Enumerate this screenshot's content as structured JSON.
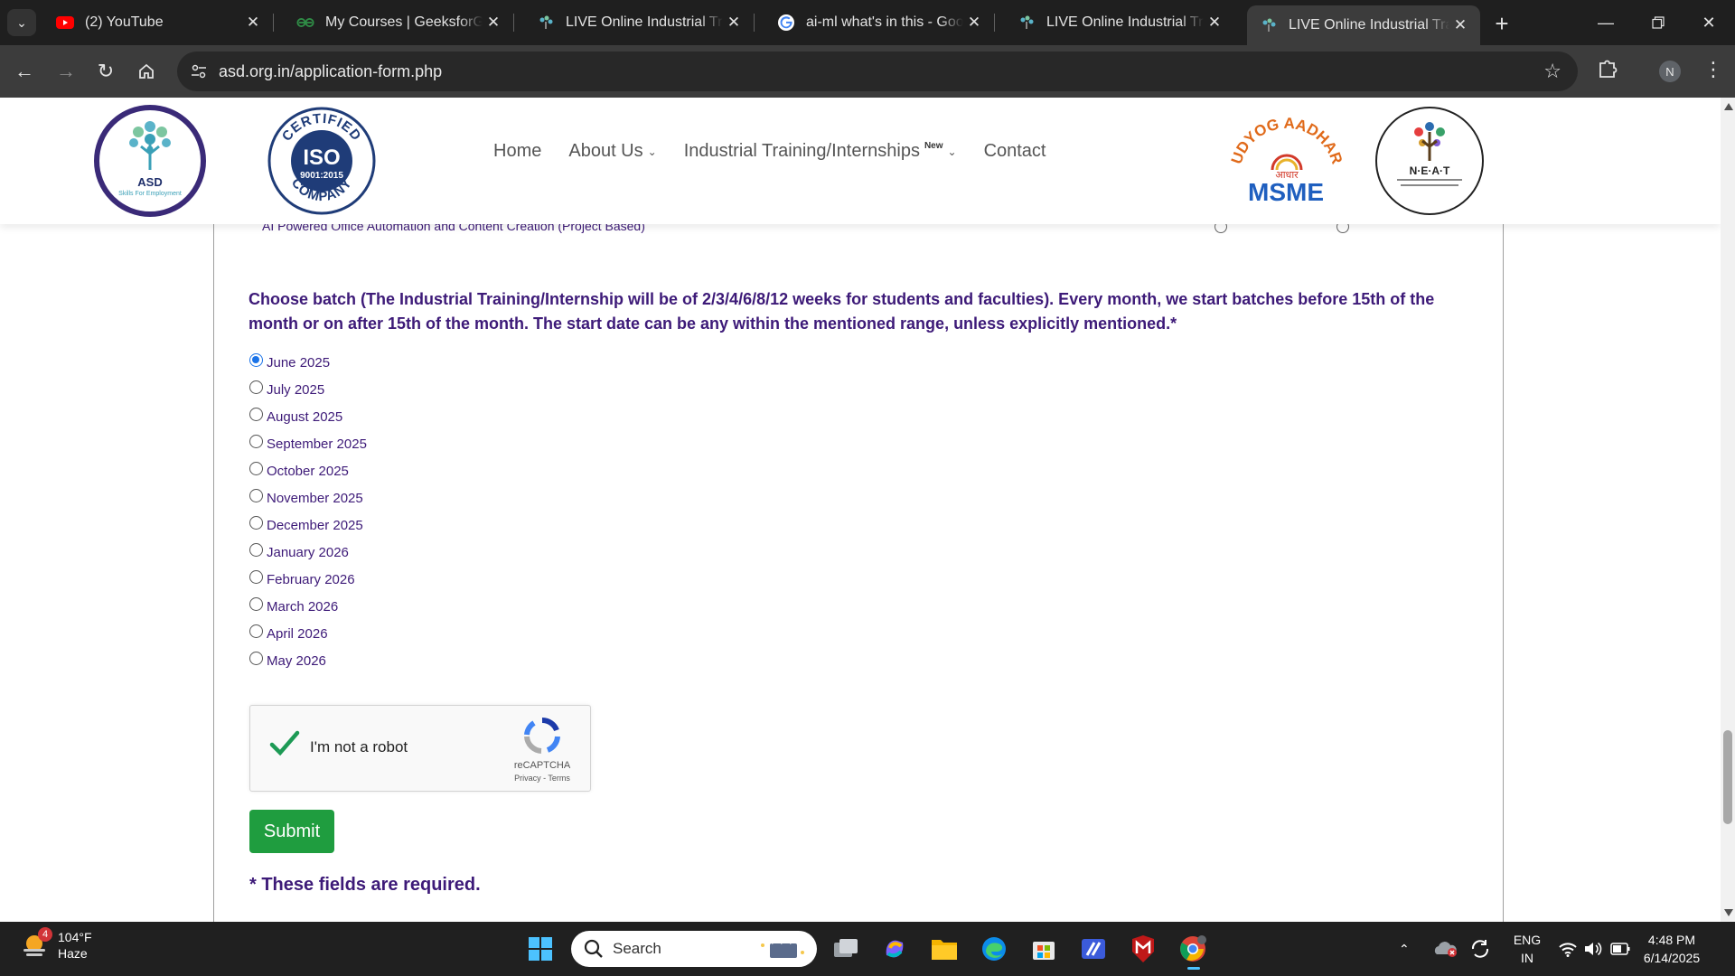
{
  "browser": {
    "tabs": [
      {
        "title": "(2) YouTube",
        "icon": "youtube-icon"
      },
      {
        "title": "My Courses | GeeksforGeeks",
        "icon": "geeksforgeeks-icon"
      },
      {
        "title": "LIVE Online Industrial Training",
        "icon": "asd-favicon-icon"
      },
      {
        "title": "ai-ml what's in this - Google Search",
        "icon": "google-icon"
      },
      {
        "title": "LIVE Online Industrial Training",
        "icon": "asd-favicon-icon"
      },
      {
        "title": "LIVE Online Industrial Training",
        "icon": "asd-favicon-icon",
        "active": true
      }
    ],
    "url": "asd.org.in/application-form.php",
    "profile_initial": "N"
  },
  "site": {
    "logo_asd_text": "ASD",
    "logo_asd_sub": "Skills For Employment",
    "iso_lines": [
      "CERTIFIED",
      "ISO",
      "9001:2015",
      "COMPANY"
    ],
    "nav": {
      "home": "Home",
      "about": "About Us",
      "training": "Industrial Training/Internships",
      "training_badge": "New",
      "contact": "Contact"
    },
    "msme_arc": "UDYOG AADHAR",
    "msme_hindi": "आधार",
    "msme_text": "MSME",
    "neat_text": "N·E·A·T"
  },
  "form": {
    "previous_course_label": "AI Powered Office Automation and Content Creation (Project Based)",
    "batch_question": "Choose batch (The Industrial Training/Internship will be of 2/3/4/6/8/12 weeks for students and faculties). Every month, we start batches before 15th of the month or on after 15th of the month. The start date can be any within the mentioned range, unless explicitly mentioned.*",
    "batches": [
      "June 2025",
      "July 2025",
      "August 2025",
      "September 2025",
      "October 2025",
      "November 2025",
      "December 2025",
      "January 2026",
      "February 2026",
      "March 2026",
      "April 2026",
      "May 2026"
    ],
    "selected_batch": "June 2025",
    "captcha_label": "I'm not a robot",
    "captcha_brand": "reCAPTCHA",
    "captcha_links": "Privacy - Terms",
    "submit_label": "Submit",
    "required_note": "* These fields are required."
  },
  "taskbar": {
    "weather_temp": "104°F",
    "weather_desc": "Haze",
    "weather_badge": "4",
    "search_placeholder": "Search",
    "lang_top": "ENG",
    "lang_bottom": "IN",
    "time": "4:48 PM",
    "date": "6/14/2025"
  }
}
